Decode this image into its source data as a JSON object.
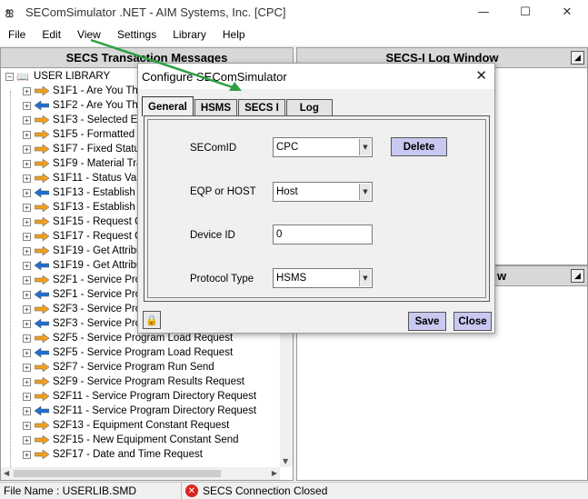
{
  "window": {
    "title": "SEComSimulator .NET - AIM Systems, Inc. [CPC]"
  },
  "menu": [
    "File",
    "Edit",
    "View",
    "Settings",
    "Library",
    "Help"
  ],
  "panels": {
    "left_title": "SECS Transaction Messages",
    "right_title": "SECS-I Log Window",
    "right2_title": "w"
  },
  "tree": {
    "root": "USER LIBRARY",
    "items": [
      {
        "label": "S1F1 - Are You The",
        "dir": "right"
      },
      {
        "label": "S1F2 - Are You The",
        "dir": "left"
      },
      {
        "label": "S1F3 - Selected Equ",
        "dir": "right"
      },
      {
        "label": "S1F5 - Formatted S",
        "dir": "right"
      },
      {
        "label": "S1F7 - Fixed Status",
        "dir": "right"
      },
      {
        "label": "S1F9 - Material Tra",
        "dir": "right"
      },
      {
        "label": "S1F11 - Status Vari",
        "dir": "right"
      },
      {
        "label": "S1F13 - Establish C",
        "dir": "left"
      },
      {
        "label": "S1F13 - Establish C",
        "dir": "right"
      },
      {
        "label": "S1F15 - Request O",
        "dir": "right"
      },
      {
        "label": "S1F17 - Request O",
        "dir": "right"
      },
      {
        "label": "S1F19 - Get Attribu",
        "dir": "right"
      },
      {
        "label": "S1F19 - Get Attribu",
        "dir": "left"
      },
      {
        "label": "S2F1 - Service Prog",
        "dir": "right"
      },
      {
        "label": "S2F1 - Service Prog",
        "dir": "left"
      },
      {
        "label": "S2F3 - Service Prog",
        "dir": "right"
      },
      {
        "label": "S2F3 - Service Prog",
        "dir": "left"
      },
      {
        "label": "S2F5 - Service Program Load Request",
        "dir": "right"
      },
      {
        "label": "S2F5 - Service Program Load Request",
        "dir": "left"
      },
      {
        "label": "S2F7 - Service Program Run Send",
        "dir": "right"
      },
      {
        "label": "S2F9 - Service Program Results Request",
        "dir": "right"
      },
      {
        "label": "S2F11 - Service Program Directory Request",
        "dir": "right"
      },
      {
        "label": "S2F11 - Service Program Directory Request",
        "dir": "left"
      },
      {
        "label": "S2F13 - Equipment Constant Request",
        "dir": "right"
      },
      {
        "label": "S2F15 - New Equipment Constant Send",
        "dir": "right"
      },
      {
        "label": "S2F17 - Date and Time Request",
        "dir": "right"
      }
    ]
  },
  "status": {
    "file": "File Name : USERLIB.SMD",
    "connection": "SECS Connection Closed"
  },
  "dialog": {
    "title": "Configure SEComSimulator",
    "tabs": [
      "General",
      "HSMS",
      "SECS I",
      "Log"
    ],
    "fields": {
      "secomid_label": "SEComID",
      "secomid_value": "CPC",
      "eqp_label": "EQP or HOST",
      "eqp_value": "Host",
      "device_label": "Device ID",
      "device_value": "0",
      "protocol_label": "Protocol Type",
      "protocol_value": "HSMS"
    },
    "buttons": {
      "delete": "Delete",
      "save": "Save",
      "close": "Close"
    }
  },
  "colors": {
    "annotation_arrow": "#2ea043",
    "button_bg": "#c8c8f0",
    "arrow_right": "#f0a020",
    "arrow_left": "#1e6fd0"
  }
}
